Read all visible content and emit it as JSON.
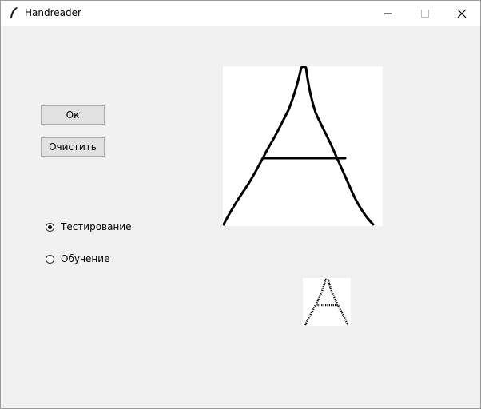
{
  "window": {
    "title": "Handreader",
    "controls": [
      "minimize-icon",
      "maximize-icon",
      "close-icon"
    ]
  },
  "buttons": {
    "ok_label": "Ок",
    "clear_label": "Очистить"
  },
  "mode": {
    "options": [
      {
        "label": "Тестирование",
        "selected": true
      },
      {
        "label": "Обучение",
        "selected": false
      }
    ]
  },
  "colors": {
    "background": "#f0f0f0",
    "canvas": "#ffffff",
    "stroke": "#000000"
  }
}
